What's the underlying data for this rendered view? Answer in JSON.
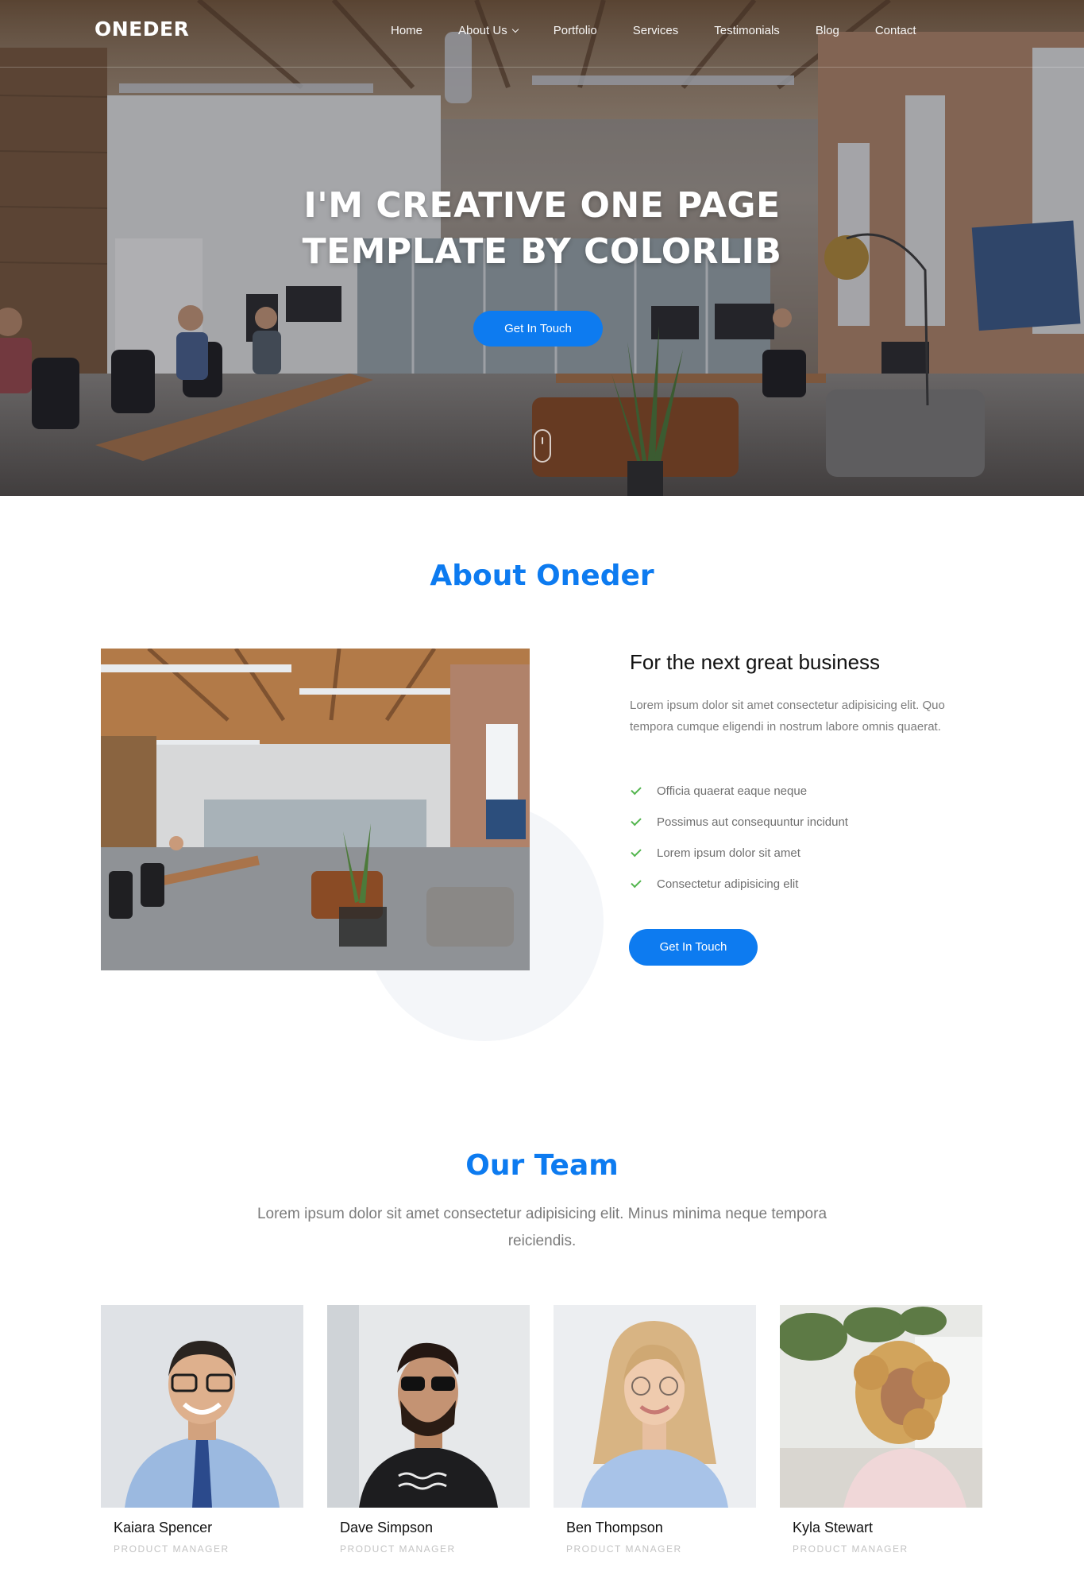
{
  "brand": {
    "logo": "ONEDER",
    "accent": "#0d7bf0"
  },
  "nav": {
    "items": [
      {
        "label": "Home"
      },
      {
        "label": "About Us",
        "has_dropdown": true
      },
      {
        "label": "Portfolio"
      },
      {
        "label": "Services"
      },
      {
        "label": "Testimonials"
      },
      {
        "label": "Blog"
      },
      {
        "label": "Contact"
      }
    ]
  },
  "hero": {
    "title_line1": "I'M CREATIVE ONE PAGE",
    "title_line2": "TEMPLATE BY COLORLIB",
    "cta": "Get In Touch"
  },
  "about": {
    "title": "About Oneder",
    "heading": "For the next great business",
    "text": "Lorem ipsum dolor sit amet consectetur adipisicing elit. Quo tempora cumque eligendi in nostrum labore omnis quaerat.",
    "checklist": [
      "Officia quaerat eaque neque",
      "Possimus aut consequuntur incidunt",
      "Lorem ipsum dolor sit amet",
      "Consectetur adipisicing elit"
    ],
    "cta": "Get In Touch"
  },
  "team": {
    "title": "Our Team",
    "subtitle": "Lorem ipsum dolor sit amet consectetur adipisicing elit. Minus minima neque tempora reiciendis.",
    "members": [
      {
        "name": "Kaiara Spencer",
        "role": "PRODUCT MANAGER"
      },
      {
        "name": "Dave Simpson",
        "role": "PRODUCT MANAGER"
      },
      {
        "name": "Ben Thompson",
        "role": "PRODUCT MANAGER"
      },
      {
        "name": "Kyla Stewart",
        "role": "PRODUCT MANAGER"
      }
    ]
  }
}
